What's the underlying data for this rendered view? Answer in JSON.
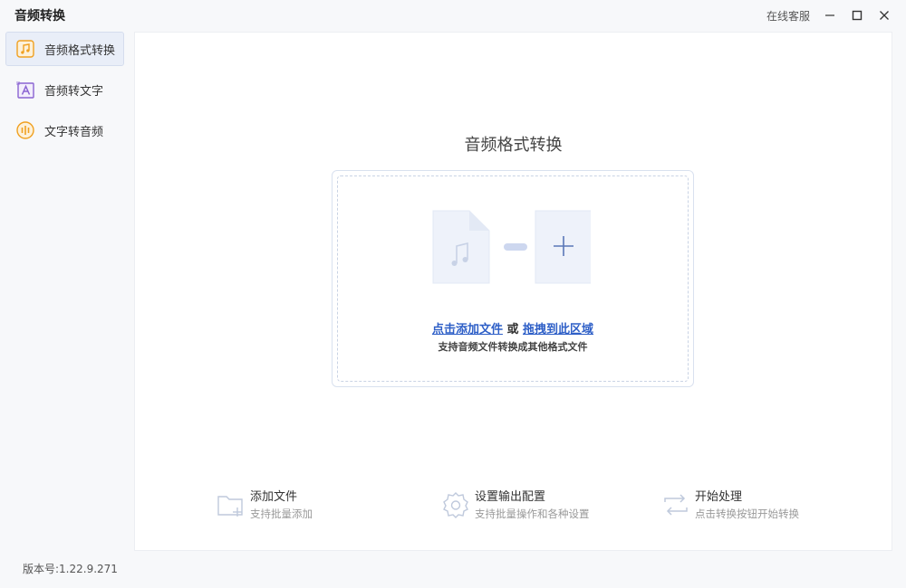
{
  "window": {
    "title": "音频转换",
    "support_label": "在线客服"
  },
  "sidebar": {
    "items": [
      {
        "label": "音频格式转换",
        "icon": "music-file-icon",
        "active": true
      },
      {
        "label": "音频转文字",
        "icon": "text-a-icon",
        "active": false
      },
      {
        "label": "文字转音频",
        "icon": "sound-wave-icon",
        "active": false
      }
    ]
  },
  "main": {
    "title": "音频格式转换",
    "dropzone": {
      "add_link": "点击添加文件",
      "or_text": "或",
      "drag_link": "拖拽到此区域",
      "subtitle": "支持音频文件转换成其他格式文件"
    },
    "steps": [
      {
        "title": "添加文件",
        "desc": "支持批量添加",
        "icon": "folder-add-icon"
      },
      {
        "title": "设置输出配置",
        "desc": "支持批量操作和各种设置",
        "icon": "gear-icon"
      },
      {
        "title": "开始处理",
        "desc": "点击转换按钮开始转换",
        "icon": "convert-arrows-icon"
      }
    ]
  },
  "footer": {
    "version": "版本号:1.22.9.271"
  },
  "colors": {
    "accent": "#2e5fc7",
    "active_bg": "#e9eef8",
    "icon_orange": "#f0a020",
    "icon_purple": "#8a63d2"
  }
}
